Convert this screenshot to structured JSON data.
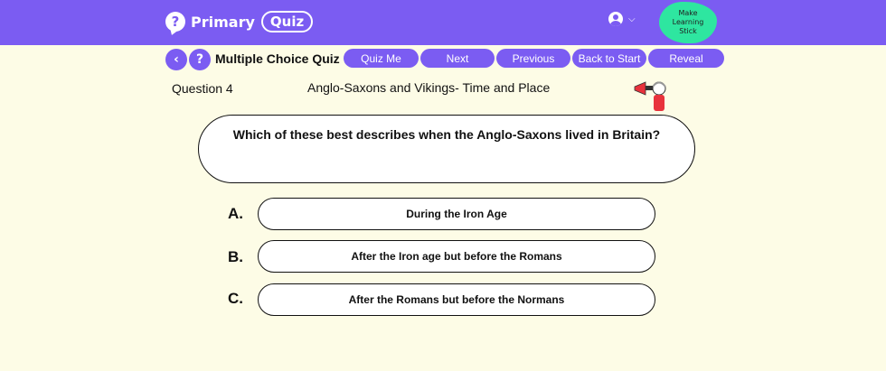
{
  "header": {
    "logo_mark": "?",
    "logo_primary": "Primary",
    "logo_quiz": "Quiz",
    "badge_text": "Make Learning Stick",
    "user_icon": "user-icon",
    "chevron": "⌵"
  },
  "nav": {
    "back_symbol": "‹",
    "help_symbol": "?",
    "title": "Multiple Choice Quiz",
    "buttons": [
      "Quiz Me",
      "Next",
      "Previous",
      "Back to Start",
      "Reveal"
    ]
  },
  "question": {
    "number": "Question 4",
    "topic": "Anglo-Saxons and Vikings- Time and Place",
    "text": "Which of these best describes when the Anglo-Saxons lived in Britain?"
  },
  "options": [
    {
      "letter": "A.",
      "text": "During the Iron Age"
    },
    {
      "letter": "B.",
      "text": "After the Iron age but before the Romans"
    },
    {
      "letter": "C.",
      "text": "After the Romans but before the Normans"
    }
  ],
  "colors": {
    "brand": "#7b5cf2",
    "background": "#fdfce6",
    "badge": "#2ee6a0"
  }
}
